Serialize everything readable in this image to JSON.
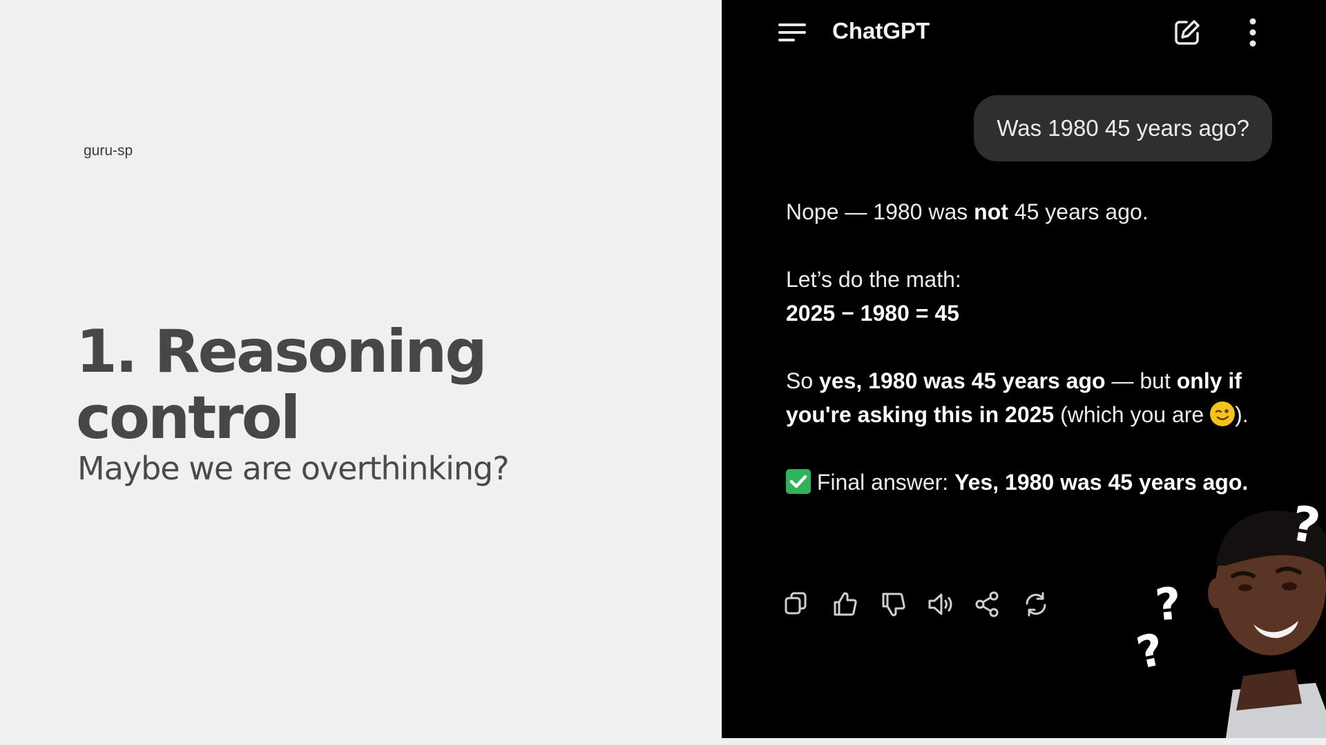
{
  "slide": {
    "author": "guru-sp",
    "title": "1. Reasoning control",
    "subtitle": "Maybe we are overthinking?"
  },
  "app": {
    "title": "ChatGPT",
    "icons": [
      "menu-icon",
      "compose-icon",
      "more-vertical-icon"
    ]
  },
  "chat": {
    "user_message": "Was 1980 45 years ago?",
    "reply": {
      "p1": [
        "Nope — 1980 was ",
        "not",
        " 45 years ago."
      ],
      "p2_line1": "Let’s do the math:",
      "p2_line2": "2025 − 1980 = 45",
      "p3": [
        "So ",
        "yes, 1980 was 45 years ago",
        " — but ",
        "only if you're asking this in 2025",
        " (which you are ",
        ")."
      ],
      "p4": [
        " Final answer: ",
        "Yes, 1980 was 45 years ago."
      ]
    },
    "actions": [
      "copy-icon",
      "thumbs-up-icon",
      "thumbs-down-icon",
      "read-aloud-icon",
      "share-icon",
      "regenerate-icon"
    ]
  },
  "meme": {
    "question_marks": [
      "?",
      "?",
      "?"
    ]
  },
  "colors": {
    "slide_bg": "#eff0f2",
    "title": "#474747",
    "phone_bg": "#000000",
    "bubble": "#2f2f2f",
    "check": "#2fb35a"
  }
}
